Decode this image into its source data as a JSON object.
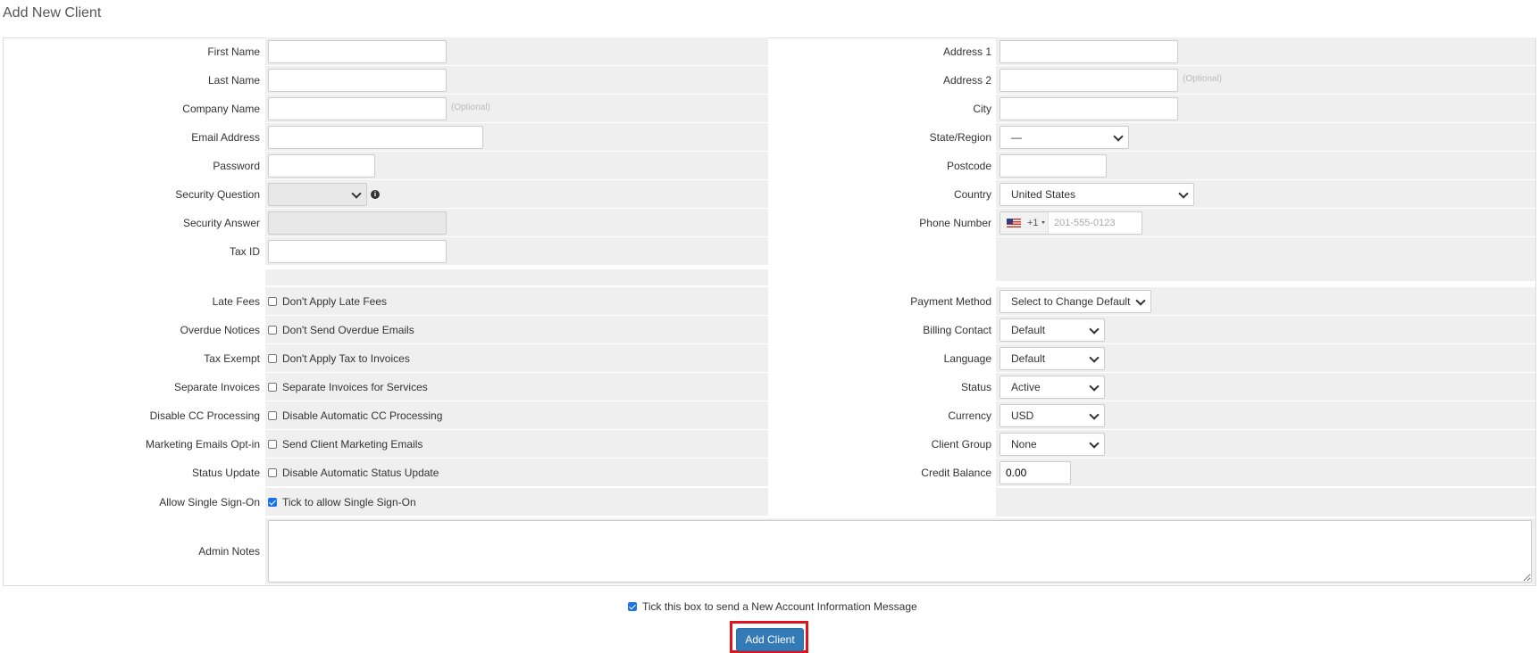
{
  "page": {
    "title": "Add New Client"
  },
  "left_fields": {
    "first_name": {
      "label": "First Name"
    },
    "last_name": {
      "label": "Last Name"
    },
    "company_name": {
      "label": "Company Name",
      "hint": "(Optional)"
    },
    "email_address": {
      "label": "Email Address"
    },
    "password": {
      "label": "Password"
    },
    "security_question": {
      "label": "Security Question",
      "icon": "info-icon"
    },
    "security_answer": {
      "label": "Security Answer"
    },
    "tax_id": {
      "label": "Tax ID"
    }
  },
  "right_fields": {
    "address1": {
      "label": "Address 1"
    },
    "address2": {
      "label": "Address 2",
      "hint": "(Optional)"
    },
    "city": {
      "label": "City"
    },
    "state_region": {
      "label": "State/Region",
      "value": "—"
    },
    "postcode": {
      "label": "Postcode"
    },
    "country": {
      "label": "Country",
      "value": "United States"
    },
    "phone_number": {
      "label": "Phone Number",
      "flag": "us-flag-icon",
      "dial_code": "+1",
      "placeholder": "201-555-0123"
    }
  },
  "options": [
    {
      "label": "Late Fees",
      "checkbox_label": "Don't Apply Late Fees",
      "checked": false
    },
    {
      "label": "Overdue Notices",
      "checkbox_label": "Don't Send Overdue Emails",
      "checked": false
    },
    {
      "label": "Tax Exempt",
      "checkbox_label": "Don't Apply Tax to Invoices",
      "checked": false
    },
    {
      "label": "Separate Invoices",
      "checkbox_label": "Separate Invoices for Services",
      "checked": false
    },
    {
      "label": "Disable CC Processing",
      "checkbox_label": "Disable Automatic CC Processing",
      "checked": false
    },
    {
      "label": "Marketing Emails Opt-in",
      "checkbox_label": "Send Client Marketing Emails",
      "checked": false
    },
    {
      "label": "Status Update",
      "checkbox_label": "Disable Automatic Status Update",
      "checked": false
    },
    {
      "label": "Allow Single Sign-On",
      "checkbox_label": "Tick to allow Single Sign-On",
      "checked": true
    }
  ],
  "billing": {
    "payment_method": {
      "label": "Payment Method",
      "value": "Select to Change Default"
    },
    "billing_contact": {
      "label": "Billing Contact",
      "value": "Default"
    },
    "language": {
      "label": "Language",
      "value": "Default"
    },
    "status": {
      "label": "Status",
      "value": "Active"
    },
    "currency": {
      "label": "Currency",
      "value": "USD"
    },
    "client_group": {
      "label": "Client Group",
      "value": "None"
    },
    "credit_balance": {
      "label": "Credit Balance",
      "value": "0.00"
    }
  },
  "admin_notes": {
    "label": "Admin Notes"
  },
  "footer": {
    "send_message_label": "Tick this box to send a New Account Information Message",
    "send_message_checked": true,
    "submit_label": "Add Client"
  },
  "colors": {
    "row_bg": "#efefef",
    "primary_button": "#337ab7",
    "highlight_outline": "#e0141e",
    "checkbox_checked": "#1a73e8"
  }
}
